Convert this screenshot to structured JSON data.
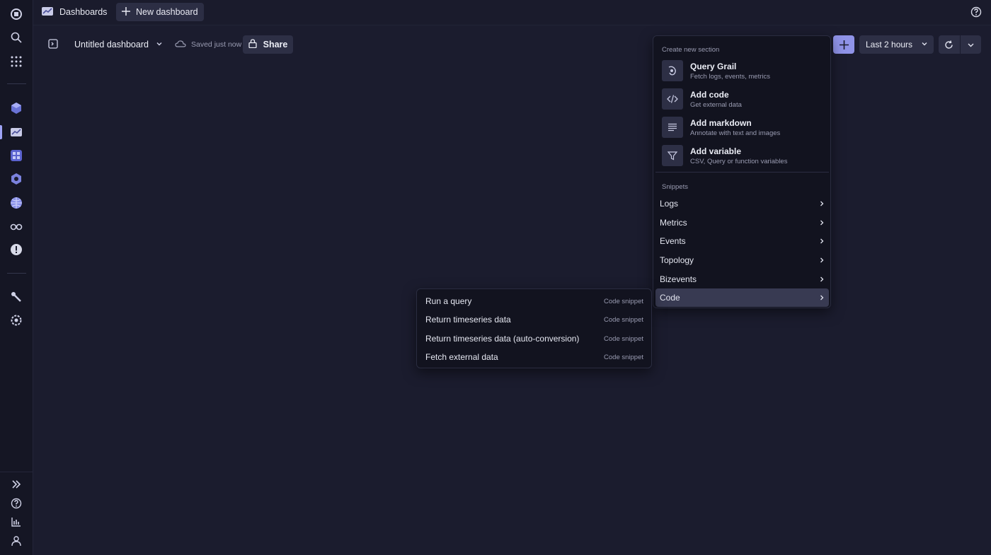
{
  "topbar": {
    "app_title": "Dashboards",
    "new_dashboard_label": "New dashboard"
  },
  "dashboard": {
    "title": "Untitled dashboard",
    "save_status": "Saved just now",
    "share_label": "Share",
    "timeframe_label": "Last 2 hours"
  },
  "create_menu": {
    "section_title": "Create new section",
    "items": [
      {
        "title": "Query Grail",
        "description": "Fetch logs, events, metrics",
        "icon": "grail-icon"
      },
      {
        "title": "Add code",
        "description": "Get external data",
        "icon": "code-icon"
      },
      {
        "title": "Add markdown",
        "description": "Annotate with text and images",
        "icon": "markdown-icon"
      },
      {
        "title": "Add variable",
        "description": "CSV, Query or function variables",
        "icon": "filter-icon"
      }
    ],
    "snippets_title": "Snippets",
    "snippets": [
      {
        "label": "Logs"
      },
      {
        "label": "Metrics"
      },
      {
        "label": "Events"
      },
      {
        "label": "Topology"
      },
      {
        "label": "Bizevents"
      },
      {
        "label": "Code"
      }
    ]
  },
  "code_submenu": {
    "items": [
      {
        "label": "Run a query",
        "tag": "Code snippet"
      },
      {
        "label": "Return timeseries data",
        "tag": "Code snippet"
      },
      {
        "label": "Return timeseries data (auto-conversion)",
        "tag": "Code snippet"
      },
      {
        "label": "Fetch external data",
        "tag": "Code snippet"
      }
    ]
  },
  "colors": {
    "background": "#1b1c2e",
    "rail": "#151624",
    "accent": "#8f93e8",
    "menu_bg": "#12131f"
  }
}
